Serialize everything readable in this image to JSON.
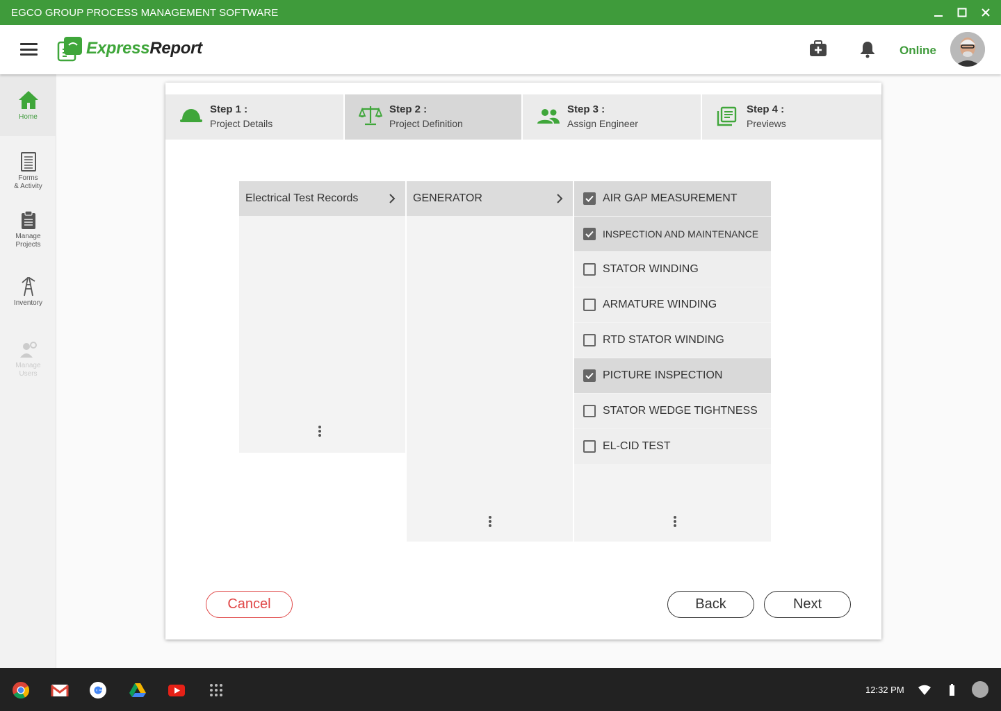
{
  "window": {
    "title": "EGCO GROUP PROCESS MANAGEMENT SOFTWARE",
    "controls": [
      "minimize-icon",
      "maximize-icon",
      "close-icon"
    ]
  },
  "header": {
    "logo_part1": "Express",
    "logo_part2": "Report",
    "status": "Online",
    "icons": [
      "menu-icon",
      "medkit-icon",
      "bell-icon",
      "avatar"
    ]
  },
  "sidebar": {
    "items": [
      {
        "label": "Home",
        "icon": "home-icon",
        "state": "active"
      },
      {
        "label1": "Forms",
        "label2": "& Activity",
        "icon": "forms-icon"
      },
      {
        "label1": "Manage",
        "label2": "Projects",
        "icon": "clipboard-icon"
      },
      {
        "label": "Inventory",
        "icon": "tower-icon"
      },
      {
        "label1": "Manage",
        "label2": "Users",
        "icon": "user-settings-icon",
        "state": "disabled"
      }
    ]
  },
  "steps": [
    {
      "title": "Step 1 :",
      "subtitle": "Project Details",
      "icon": "hard-hat-icon"
    },
    {
      "title": "Step 2 :",
      "subtitle": "Project Definition",
      "icon": "scale-icon",
      "active": true
    },
    {
      "title": "Step 3 :",
      "subtitle": "Assign Engineer",
      "icon": "people-icon"
    },
    {
      "title": "Step 4 :",
      "subtitle": "Previews",
      "icon": "library-icon"
    }
  ],
  "columns": {
    "category": "Electrical Test Records",
    "equipment": "GENERATOR",
    "tests": [
      {
        "label": "AIR GAP MEASUREMENT",
        "checked": true
      },
      {
        "label": "INSPECTION AND MAINTENANCE",
        "checked": true
      },
      {
        "label": "STATOR WINDING",
        "checked": false
      },
      {
        "label": "ARMATURE WINDING",
        "checked": false
      },
      {
        "label": "RTD STATOR WINDING",
        "checked": false
      },
      {
        "label": "PICTURE INSPECTION",
        "checked": true
      },
      {
        "label": "STATOR WEDGE TIGHTNESS",
        "checked": false
      },
      {
        "label": "EL-CID TEST",
        "checked": false
      }
    ]
  },
  "buttons": {
    "cancel": "Cancel",
    "back": "Back",
    "next": "Next"
  },
  "taskbar": {
    "apps": [
      "chrome-icon",
      "gmail-icon",
      "google-icon",
      "drive-icon",
      "youtube-icon",
      "launcher-icon"
    ],
    "time": "12:32 PM"
  },
  "colors": {
    "brand_green": "#3f9b3b",
    "cancel_red": "#e04848"
  }
}
